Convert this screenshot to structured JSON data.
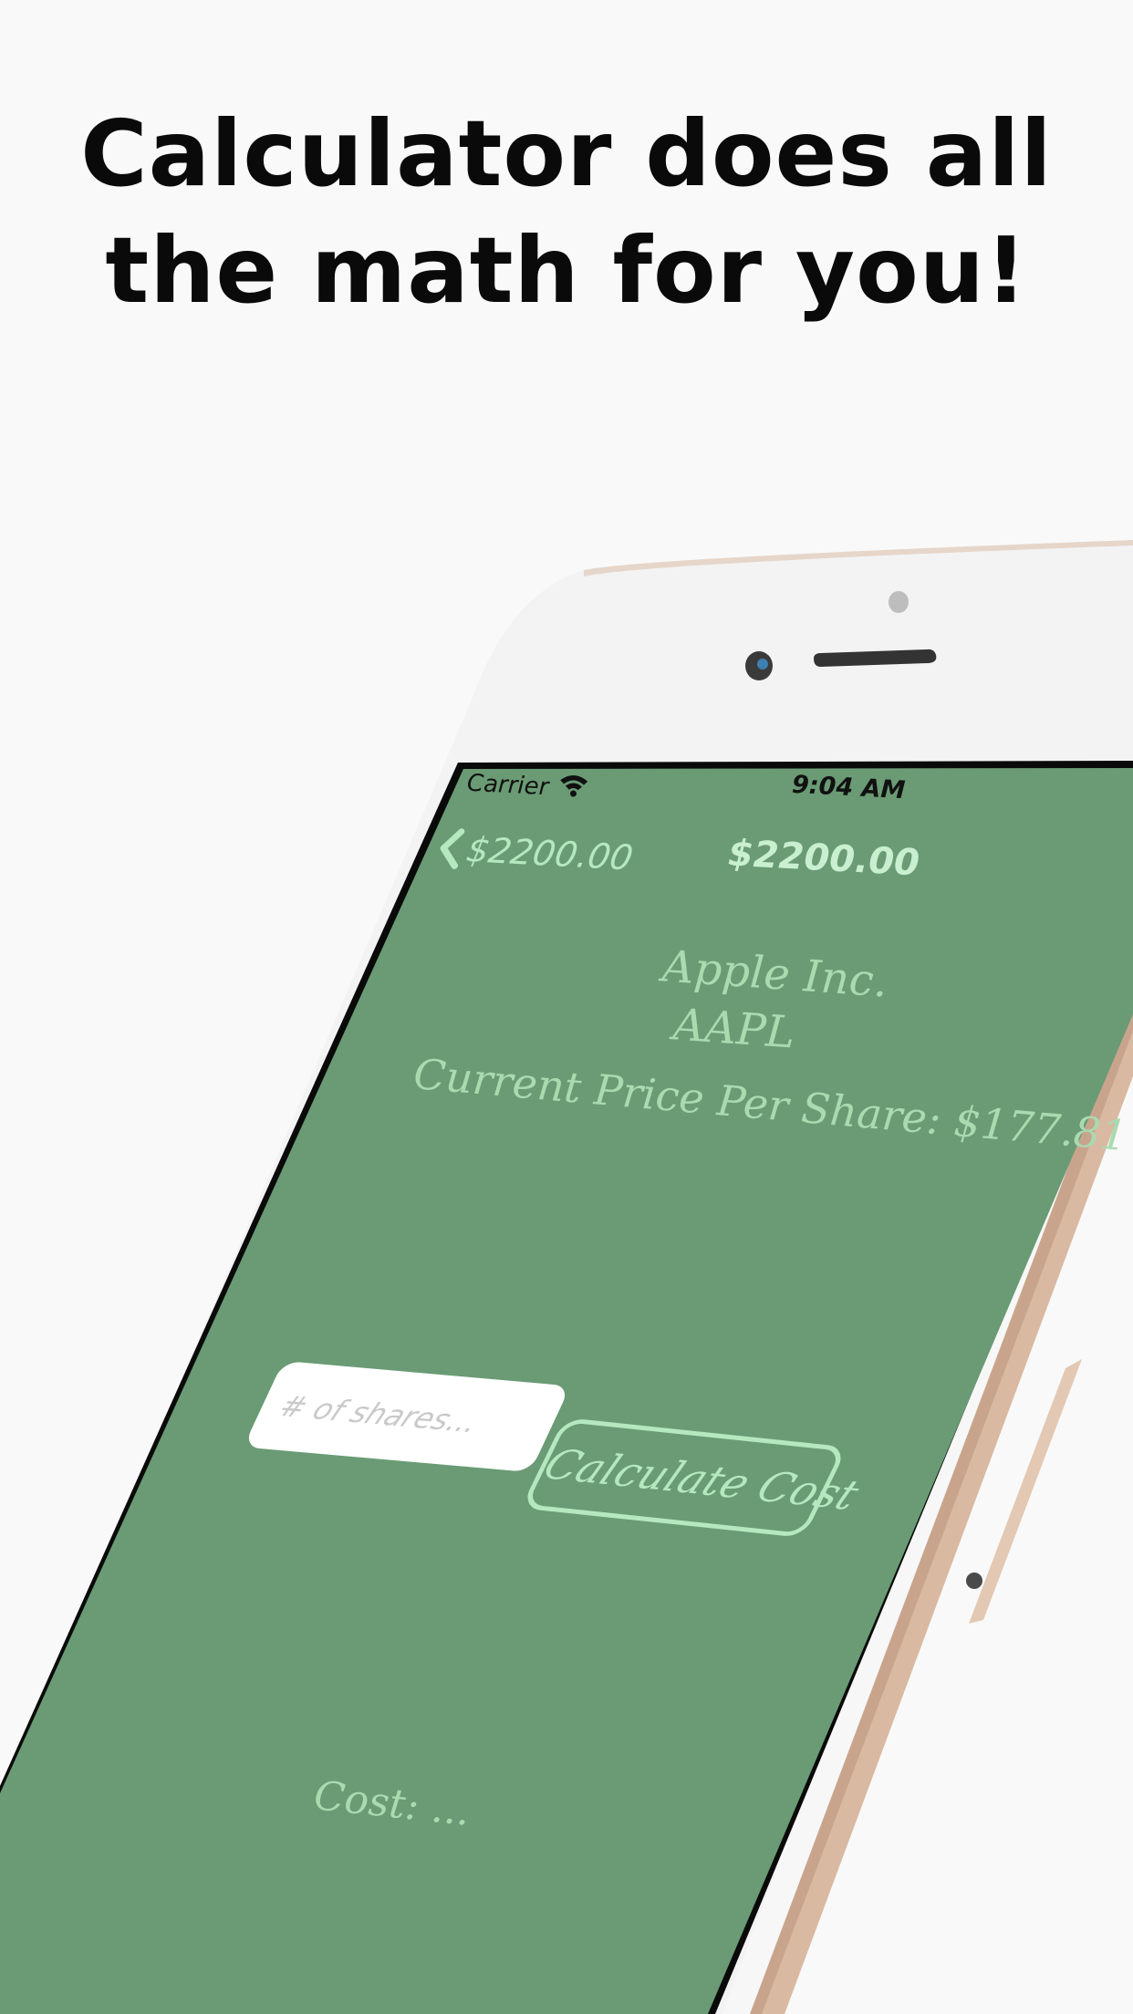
{
  "headline": {
    "line1": "Calculator does all",
    "line2": "the math for you!"
  },
  "status_bar": {
    "carrier": "Carrier",
    "time": "9:04 AM",
    "wifi_icon": "wifi-icon"
  },
  "nav": {
    "back_label": "$2200.00",
    "title": "$2200.00",
    "back_icon": "chevron-left-icon"
  },
  "stock": {
    "company": "Apple Inc.",
    "ticker": "AAPL",
    "price_line": "Current Price Per Share:  $177.81"
  },
  "calculator": {
    "shares_placeholder": "# of shares...",
    "calculate_label": "Calculate Cost",
    "cost_label": "Cost:  ..."
  },
  "colors": {
    "screen_background": "#6a9b74",
    "accent_text": "#b6e8bf",
    "page_background": "#f9f9f9",
    "phone_body": "#f4f4f5",
    "phone_frame_gold": "#d8b9a3"
  }
}
